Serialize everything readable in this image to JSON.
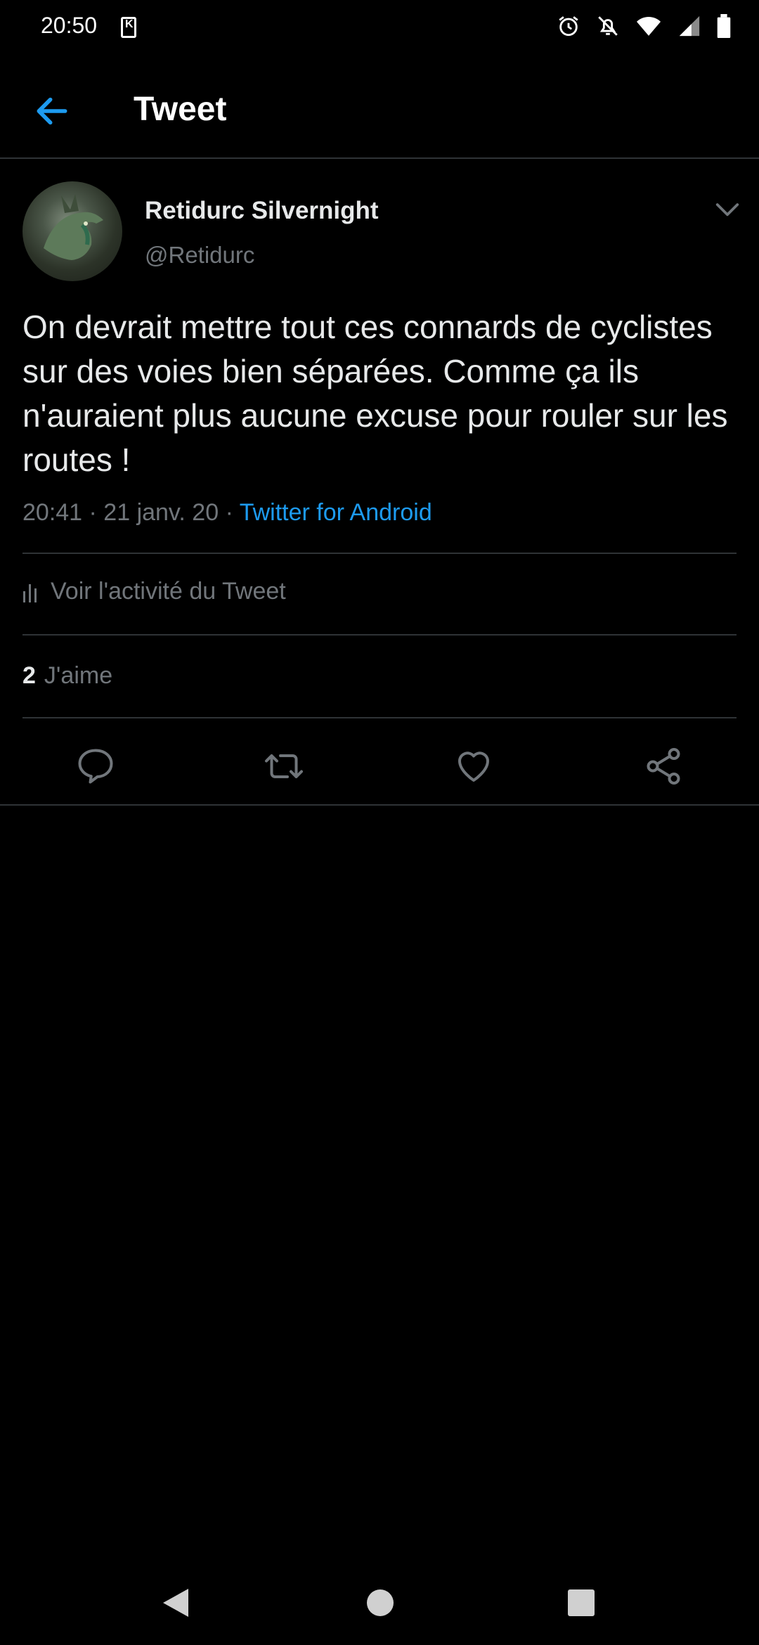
{
  "status_bar": {
    "time": "20:50"
  },
  "header": {
    "title": "Tweet"
  },
  "tweet": {
    "author_name": "Retidurc Silvernight",
    "author_handle": "@Retidurc",
    "text": "On devrait mettre tout ces connards de cyclistes sur des voies bien séparées. Comme ça ils n'auraient plus aucune excuse pour rouler sur les routes !",
    "time_date": "20:41 · 21 janv. 20 · ",
    "source": "Twitter for Android",
    "activity_label": "Voir l'activité du Tweet",
    "likes_count": "2",
    "likes_label": "J'aime"
  },
  "colors": {
    "accent": "#1d9bf0",
    "background": "#000000",
    "secondary_text": "#71767b",
    "divider": "#2f3336"
  }
}
